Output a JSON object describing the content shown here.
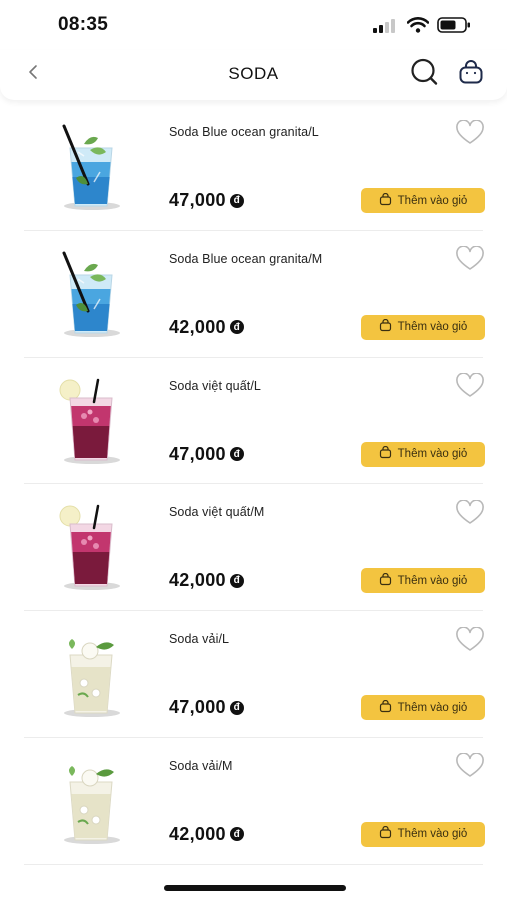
{
  "status_bar": {
    "time": "08:35"
  },
  "header": {
    "title": "SODA"
  },
  "currency_symbol": "đ",
  "colors": {
    "accent": "#f3c440",
    "text": "#111111",
    "divider": "#ececec"
  },
  "products": [
    {
      "name": "Soda Blue ocean granita/L",
      "price": "47,000",
      "button_label": "Thêm vào giỏ",
      "drink": "blue"
    },
    {
      "name": "Soda Blue ocean granita/M",
      "price": "42,000",
      "button_label": "Thêm vào giỏ",
      "drink": "blue"
    },
    {
      "name": "Soda việt quất/L",
      "price": "47,000",
      "button_label": "Thêm vào giỏ",
      "drink": "berry"
    },
    {
      "name": "Soda việt quất/M",
      "price": "42,000",
      "button_label": "Thêm vào giỏ",
      "drink": "berry"
    },
    {
      "name": "Soda vải/L",
      "price": "47,000",
      "button_label": "Thêm vào giỏ",
      "drink": "lychee"
    },
    {
      "name": "Soda vải/M",
      "price": "42,000",
      "button_label": "Thêm vào giỏ",
      "drink": "lychee"
    }
  ]
}
